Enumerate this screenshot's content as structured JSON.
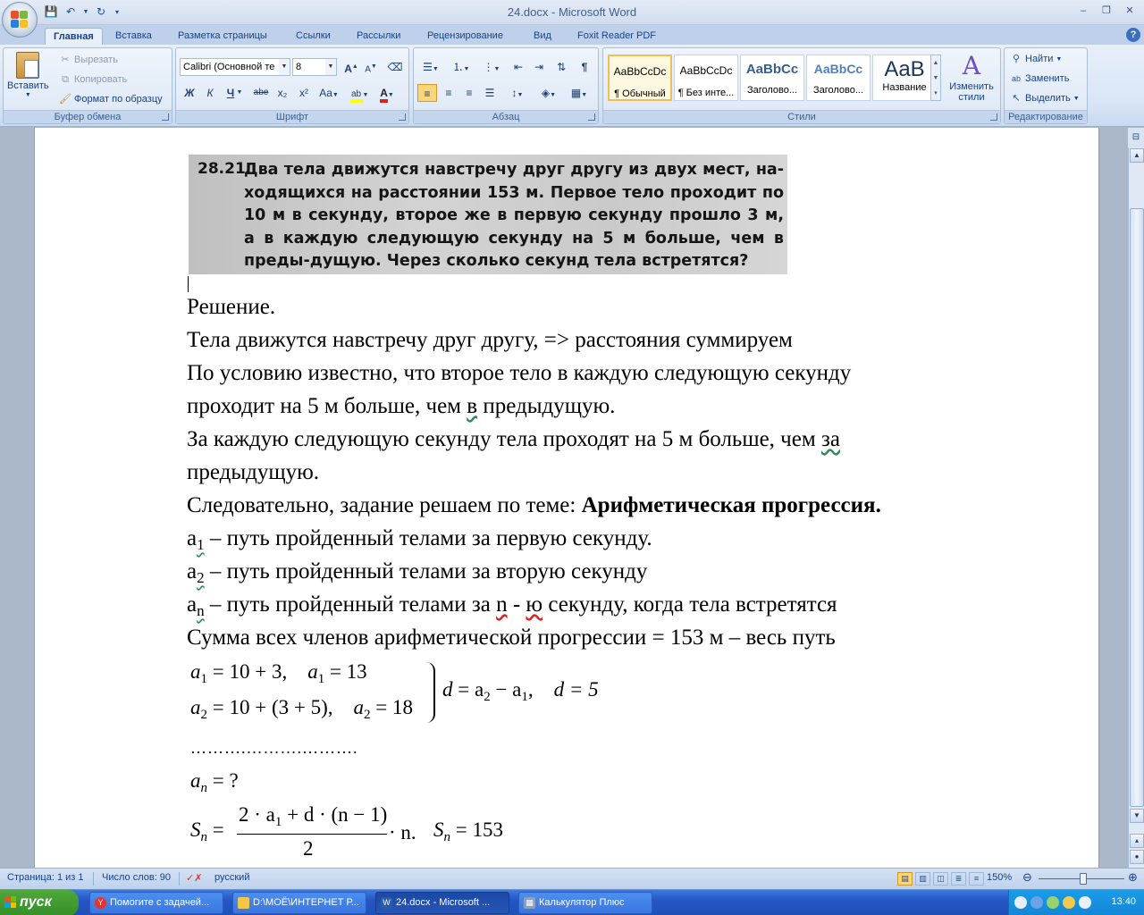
{
  "window": {
    "title": "24.docx - Microsoft Word",
    "minimize_glyph": "–",
    "maximize_glyph": "❐",
    "close_glyph": "✕",
    "help_glyph": "?"
  },
  "qat": {
    "save_icon": "save-icon",
    "undo_icon": "undo-icon",
    "redo_icon": "redo-icon"
  },
  "tabs": [
    {
      "label": "Главная",
      "active": true
    },
    {
      "label": "Вставка"
    },
    {
      "label": "Разметка страницы"
    },
    {
      "label": "Ссылки"
    },
    {
      "label": "Рассылки"
    },
    {
      "label": "Рецензирование"
    },
    {
      "label": "Вид"
    },
    {
      "label": "Foxit Reader PDF"
    }
  ],
  "ribbon": {
    "clipboard": {
      "label": "Буфер обмена",
      "paste": "Вставить",
      "cut": "Вырезать",
      "copy": "Копировать",
      "format_painter": "Формат по образцу"
    },
    "font": {
      "label": "Шрифт",
      "font_name": "Calibri (Основной те",
      "font_size": "8",
      "bold": "Ж",
      "italic": "К",
      "underline": "Ч",
      "strike": "abe",
      "subscript": "x₂",
      "superscript": "x²",
      "change_case": "Aa",
      "grow": "A",
      "shrink": "A",
      "font_color_letter": "A"
    },
    "paragraph": {
      "label": "Абзац"
    },
    "styles": {
      "label": "Стили",
      "items": [
        {
          "sample": "AaBbCcDc",
          "name": "¶ Обычный",
          "selected": true
        },
        {
          "sample": "AaBbCcDc",
          "name": "¶ Без инте..."
        },
        {
          "sample": "AaBbCc",
          "name": "Заголово..."
        },
        {
          "sample": "AaBbCc",
          "name": "Заголово..."
        },
        {
          "sample": "AaB",
          "name": "Название"
        }
      ],
      "change_styles": "Изменить стили"
    },
    "editing": {
      "label": "Редактирование",
      "find": "Найти",
      "replace": "Заменить",
      "select": "Выделить"
    }
  },
  "document": {
    "problem": {
      "number": "28.21.",
      "text": "Два тела движутся навстречу друг другу из двух мест, на-ходящихся на расстоянии 153 м. Первое тело проходит по 10 м в секунду, второе же в первую секунду прошло 3 м, а в каждую следующую секунду на 5 м больше, чем в преды-дущую. Через сколько секунд тела встретятся?"
    },
    "lines": {
      "l1": "Решение.",
      "l2": "Тела движутся навстречу друг другу, => расстояния суммируем",
      "l3": "По условию известно, что второе тело в каждую следующую секунду",
      "l4a": "проходит на 5 м больше, чем ",
      "l4b": "в",
      "l4c": " предыдущую.",
      "l5a": "За каждую следующую секунду тела проходят на 5 м больше, чем ",
      "l5b": "за",
      "l6": "предыдущую.",
      "l7a": "Следовательно, задание решаем по теме: ",
      "l7b": "Арифметическая прогрессия.",
      "l8a": "а",
      "l8s": "1",
      "l8b": " – путь пройденный телами за первую секунду.",
      "l9a": "а",
      "l9s": "2",
      "l9b": " – путь пройденный телами за вторую секунду",
      "l10a": "а",
      "l10s": "n",
      "l10b": " – путь пройденный телами за ",
      "l10c": "n",
      "l10d": " - ",
      "l10e": "ю",
      "l10f": " секунду, когда тела встретятся",
      "l11": "Сумма всех членов арифметической прогрессии = 153 м – весь путь"
    },
    "formulas": {
      "f1a": "= 10 + 3,",
      "f1b": "= 13",
      "f2a": "= 10 + (3 + 5),",
      "f2b": "= 18",
      "f3": "= a",
      "f3b": " − a",
      "f3c": "d = 5",
      "dots": "……….……….……….",
      "an": "= ?",
      "sn_num": "2 · a",
      "sn_num2": " + d · (n − 1)",
      "sn_den": "2",
      "sn_tail": "· n.",
      "sn_val": "= 153"
    }
  },
  "status": {
    "page": "Страница: 1 из 1",
    "words": "Число слов: 90",
    "language": "русский",
    "zoom": "150%",
    "zoom_level_percent": 150
  },
  "taskbar": {
    "start": "пуск",
    "tasks": [
      {
        "label": "Помогите с задачей..."
      },
      {
        "label": "D:\\МОЁ\\ИНТЕРНЕТ Р..."
      },
      {
        "label": "24.docx - Microsoft ...",
        "active": true
      },
      {
        "label": "Калькулятор Плюс"
      }
    ],
    "clock": "13:40"
  }
}
